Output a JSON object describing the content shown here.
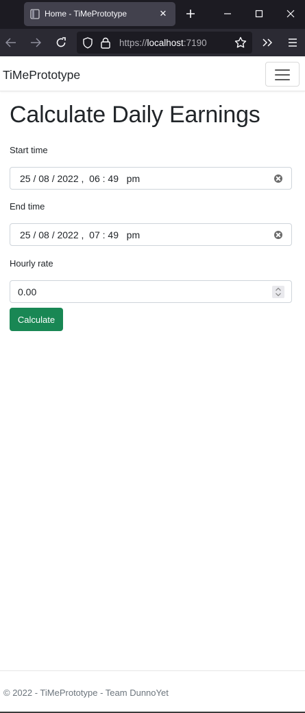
{
  "browser": {
    "tab": {
      "title": "Home - TiMePrototype"
    },
    "url": {
      "scheme": "https://",
      "host": "localhost",
      "port": ":7190"
    },
    "icons": [
      "favicon-icon",
      "tab-close-icon",
      "new-tab-icon",
      "minimize-icon",
      "maximize-icon",
      "window-close-icon",
      "back-arrow-icon",
      "forward-arrow-icon",
      "reload-icon",
      "shield-icon",
      "lock-icon",
      "bookmark-star-icon",
      "overflow-chevrons-icon",
      "hamburger-menu-icon"
    ]
  },
  "app": {
    "brand": "TiMePrototype",
    "title": "Calculate Daily Earnings",
    "form": {
      "start_label": "Start time",
      "start_value": "25 / 08 / 2022 ,  06 : 49   pm",
      "end_label": "End time",
      "end_value": "25 / 08 / 2022 ,  07 : 49   pm",
      "rate_label": "Hourly rate",
      "rate_value": "0.00",
      "submit_label": "Calculate"
    },
    "footer": "© 2022 - TiMePrototype - Team DunnoYet"
  },
  "colors": {
    "accent_button": "#198754",
    "tabbar_bg": "#1c1b22",
    "toolbar_bg": "#2b2a33"
  }
}
